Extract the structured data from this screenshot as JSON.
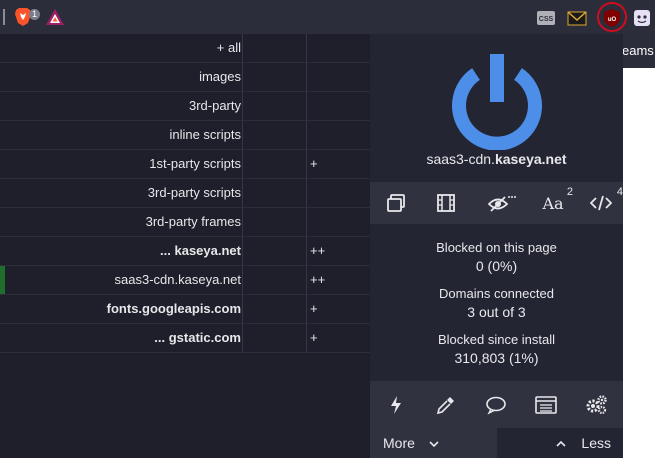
{
  "toolbar": {
    "brave_badge": "1",
    "extensions": [
      "css-viewer-extension",
      "mail-extension",
      "ublock-origin-extension",
      "ghost-extension"
    ]
  },
  "page_fragment": {
    "tab_text": "eams"
  },
  "firewall": {
    "rows": [
      {
        "label": "+ all",
        "col2": "",
        "bold": false
      },
      {
        "label": "images",
        "col2": "",
        "bold": false
      },
      {
        "label": "3rd-party",
        "col2": "",
        "bold": false
      },
      {
        "label": "inline scripts",
        "col2": "",
        "bold": false
      },
      {
        "label": "1st-party scripts",
        "col2": "+",
        "bold": false
      },
      {
        "label": "3rd-party scripts",
        "col2": "",
        "bold": false
      },
      {
        "label": "3rd-party frames",
        "col2": "",
        "bold": false
      },
      {
        "label": "... kaseya.net",
        "col2": "++",
        "bold": true
      },
      {
        "label": "saas3-cdn.kaseya.net",
        "col2": "++",
        "bold": false
      },
      {
        "label": "fonts.googleapis.com",
        "col2": "+",
        "bold": true
      },
      {
        "label": "... gstatic.com",
        "col2": "+",
        "bold": true
      }
    ]
  },
  "main": {
    "hostname_sub": "saas3-cdn.",
    "hostname_domain": "kaseya.net",
    "tools": {
      "fonts_label": "Aa",
      "fonts_count": "2",
      "scripts_count": "4"
    },
    "stats": {
      "blocked_page_label": "Blocked on this page",
      "blocked_page_value": "0 (0%)",
      "domains_label": "Domains connected",
      "domains_value": "3 out of 3",
      "blocked_install_label": "Blocked since install",
      "blocked_install_value": "310,803 (1%)"
    },
    "more_label": "More",
    "less_label": "Less"
  },
  "colors": {
    "power_blue": "#4d8ee8",
    "toolbar_bg": "#2b2d3a",
    "popup_bg": "#1e1f2a",
    "panel_bg": "#232533",
    "row_bg": "#30323f",
    "highlight_ring": "#d00d1f",
    "first_party_mark": "#1d6f2b"
  }
}
